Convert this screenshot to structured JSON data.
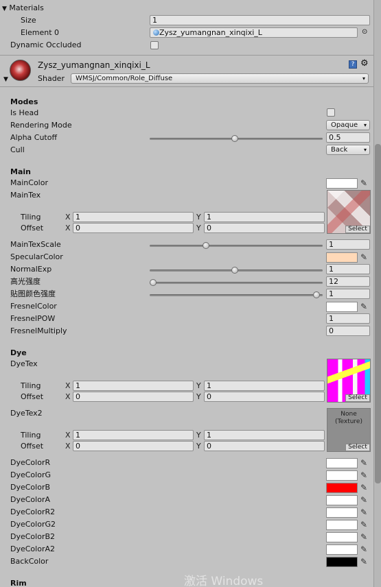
{
  "materials": {
    "header": "Materials",
    "size_label": "Size",
    "size_value": "1",
    "element_label": "Element 0",
    "element_value": "Zysz_yumangnan_xinqixi_L"
  },
  "dynamic_occluded_label": "Dynamic Occluded",
  "material_header": {
    "name": "Zysz_yumangnan_xinqixi_L",
    "shader_label": "Shader",
    "shader_value": "WMSJ/Common/Role_Diffuse"
  },
  "modes": {
    "title": "Modes",
    "is_head_label": "Is Head",
    "rendering_mode_label": "Rendering Mode",
    "rendering_mode_value": "Opaque",
    "alpha_cutoff_label": "Alpha Cutoff",
    "alpha_cutoff_value": "0.5",
    "alpha_cutoff_fraction": 0.5,
    "cull_label": "Cull",
    "cull_value": "Back"
  },
  "main": {
    "title": "Main",
    "main_color_label": "MainColor",
    "main_tex_label": "MainTex",
    "tiling_label": "Tiling",
    "offset_label": "Offset",
    "x": "X",
    "y": "Y",
    "tiling_x": "1",
    "tiling_y": "1",
    "offset_x": "0",
    "offset_y": "0",
    "select": "Select",
    "main_tex_scale_label": "MainTexScale",
    "main_tex_scale_value": "1",
    "main_tex_scale_fraction": 0.33,
    "specular_color_label": "SpecularColor",
    "normal_exp_label": "NormalExp",
    "normal_exp_value": "1",
    "normal_exp_fraction": 0.5,
    "highlight_label": "高光强度",
    "highlight_value": "12",
    "highlight_fraction": 0.02,
    "tex_color_label": "贴图颜色强度",
    "tex_color_value": "1",
    "tex_color_fraction": 0.98,
    "fresnel_color_label": "FresnelColor",
    "fresnel_pow_label": "FresnelPOW",
    "fresnel_pow_value": "1",
    "fresnel_multiply_label": "FresnelMultiply",
    "fresnel_multiply_value": "0"
  },
  "dye": {
    "title": "Dye",
    "dye_tex_label": "DyeTex",
    "dye_tex2_label": "DyeTex2",
    "none_texture": "None\n(Texture)",
    "colors": [
      {
        "label": "DyeColorR",
        "color": "#ffffff"
      },
      {
        "label": "DyeColorG",
        "color": "#ffffff"
      },
      {
        "label": "DyeColorB",
        "color": "#ff0000"
      },
      {
        "label": "DyeColorA",
        "color": "#ffffff"
      },
      {
        "label": "DyeColorR2",
        "color": "#ffffff"
      },
      {
        "label": "DyeColorG2",
        "color": "#ffffff"
      },
      {
        "label": "DyeColorB2",
        "color": "#ffffff"
      },
      {
        "label": "DyeColorA2",
        "color": "#ffffff"
      },
      {
        "label": "BackColor",
        "color": "#000000"
      }
    ]
  },
  "rim_title": "Rim",
  "watermark": "激活 Windows",
  "colors": {
    "main_color": "#ffffff",
    "specular_color": "#ffd9b8",
    "fresnel_color": "#ffffff"
  }
}
